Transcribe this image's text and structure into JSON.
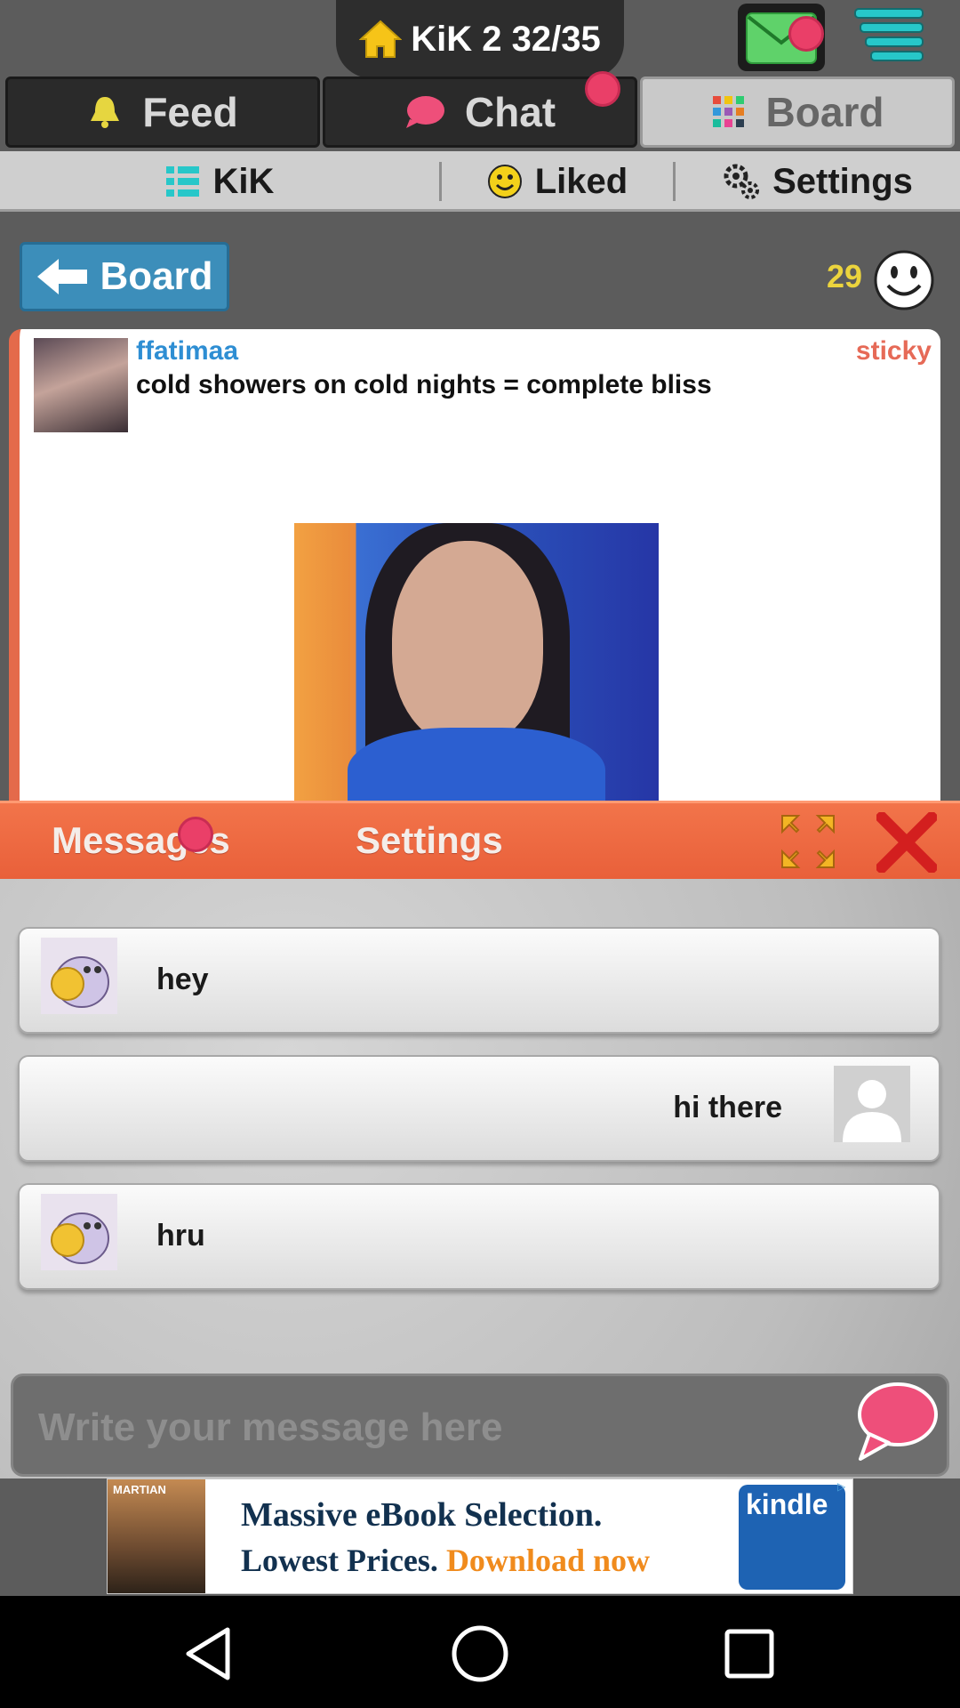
{
  "header": {
    "home_title": "KiK 2 32/35",
    "icons": [
      "home-icon",
      "mail-icon",
      "menu-icon"
    ]
  },
  "tabs": [
    {
      "label": "Feed",
      "icon": "bell-icon"
    },
    {
      "label": "Chat",
      "icon": "chat-bubble-icon"
    },
    {
      "label": "Board",
      "icon": "grid-icon",
      "active": true
    }
  ],
  "subtabs": [
    {
      "label": "KiK",
      "icon": "list-icon"
    },
    {
      "label": "Liked",
      "icon": "smiley-icon"
    },
    {
      "label": "Settings",
      "icon": "gears-icon"
    }
  ],
  "board": {
    "back_label": "Board",
    "count": "29"
  },
  "post": {
    "username": "ffatimaa",
    "tag": "sticky",
    "message": "cold showers on cold nights = complete bliss"
  },
  "panel": {
    "tabs": [
      "Messages",
      "Settings"
    ],
    "messages": [
      {
        "text": "hey",
        "side": "left"
      },
      {
        "text": "hi there",
        "side": "right"
      },
      {
        "text": "hru",
        "side": "left"
      }
    ],
    "compose_placeholder": "Write your message here"
  },
  "ad": {
    "poster_title": "MARTIAN",
    "line1": "Massive eBook Selection.",
    "line2_prefix": "Lowest Prices.",
    "line2_cta": "Download now",
    "brand": "kindle"
  },
  "colors": {
    "accent_orange": "#e9603a",
    "notification_dot": "#ea3f68",
    "username_blue": "#2e8ed3",
    "sticky_red": "#e66a57",
    "count_yellow": "#ecd43d"
  }
}
